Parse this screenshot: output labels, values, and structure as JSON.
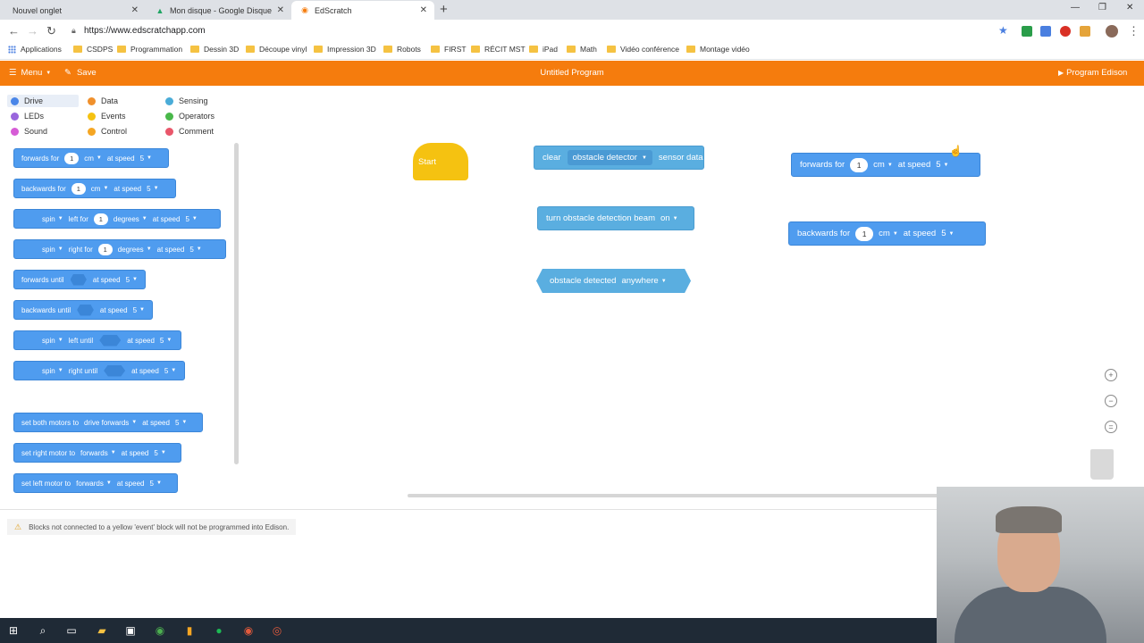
{
  "browser": {
    "tabs": [
      {
        "label": "Nouvel onglet",
        "close": "✕"
      },
      {
        "label": "Mon disque - Google Disque",
        "close": "✕"
      },
      {
        "label": "EdScratch",
        "close": "✕"
      }
    ],
    "new_tab": "+",
    "window_controls": {
      "minimize": "—",
      "maximize": "❐",
      "close": "✕"
    },
    "url": "https://www.edscratchapp.com"
  },
  "bookmarks": [
    "Applications",
    "CSDPS",
    "Programmation",
    "Dessin 3D",
    "Découpe vinyl",
    "Impression 3D",
    "Robots",
    "FIRST",
    "RÉCIT MST",
    "iPad",
    "Math",
    "Vidéo conférence",
    "Montage vidéo"
  ],
  "app": {
    "menu_label": "Menu",
    "save_label": "Save",
    "title": "Untitled Program",
    "program_label": "Program Edison",
    "accent": "#f57c0d"
  },
  "categories": [
    {
      "label": "Drive",
      "color": "#4a86e8"
    },
    {
      "label": "Data",
      "color": "#f0902c"
    },
    {
      "label": "Sensing",
      "color": "#4aacd8"
    },
    {
      "label": "LEDs",
      "color": "#9966dd"
    },
    {
      "label": "Events",
      "color": "#f5c211"
    },
    {
      "label": "Operators",
      "color": "#49b84a"
    },
    {
      "label": "Sound",
      "color": "#d65cd6"
    },
    {
      "label": "Control",
      "color": "#f5a623"
    },
    {
      "label": "Comment",
      "color": "#e9566a"
    }
  ],
  "palette": {
    "forwards_for": {
      "text": "forwards for",
      "value": "1",
      "unit": "cm",
      "speed_label": "at speed",
      "speed": "5"
    },
    "backwards_for": {
      "text": "backwards for",
      "value": "1",
      "unit": "cm",
      "speed_label": "at speed",
      "speed": "5"
    },
    "spin_left_for": {
      "spin": "spin",
      "dir": "left for",
      "value": "1",
      "unit": "degrees",
      "speed_label": "at speed",
      "speed": "5"
    },
    "spin_right_for": {
      "spin": "spin",
      "dir": "right for",
      "value": "1",
      "unit": "degrees",
      "speed_label": "at speed",
      "speed": "5"
    },
    "forwards_until": {
      "text": "forwards until",
      "speed_label": "at speed",
      "speed": "5"
    },
    "backwards_until": {
      "text": "backwards until",
      "speed_label": "at speed",
      "speed": "5"
    },
    "spin_left_until": {
      "spin": "spin",
      "dir": "left until",
      "speed_label": "at speed",
      "speed": "5"
    },
    "spin_right_until": {
      "spin": "spin",
      "dir": "right until",
      "speed_label": "at speed",
      "speed": "5"
    },
    "set_both": {
      "text": "set both motors to",
      "option": "drive forwards",
      "speed_label": "at speed",
      "speed": "5"
    },
    "set_right": {
      "text": "set right motor to",
      "option": "forwards",
      "speed_label": "at speed",
      "speed": "5"
    },
    "set_left": {
      "text": "set left motor to",
      "option": "forwards",
      "speed_label": "at speed",
      "speed": "5"
    }
  },
  "workspace": {
    "start_label": "Start",
    "clear_block": {
      "text": "clear",
      "option": "obstacle detector",
      "suffix": "sensor data"
    },
    "beam_block": {
      "text": "turn obstacle detection beam",
      "option": "on"
    },
    "detected_block": {
      "text": "obstacle detected",
      "option": "anywhere"
    },
    "forwards_block": {
      "text": "forwards for",
      "value": "1",
      "unit": "cm",
      "speed_label": "at speed",
      "speed": "5"
    },
    "backwards_block": {
      "text": "backwards for",
      "value": "1",
      "unit": "cm",
      "speed_label": "at speed",
      "speed": "5"
    }
  },
  "status": {
    "warning": "Blocks not connected to a yellow 'event' block will not be programmed into Edison."
  }
}
